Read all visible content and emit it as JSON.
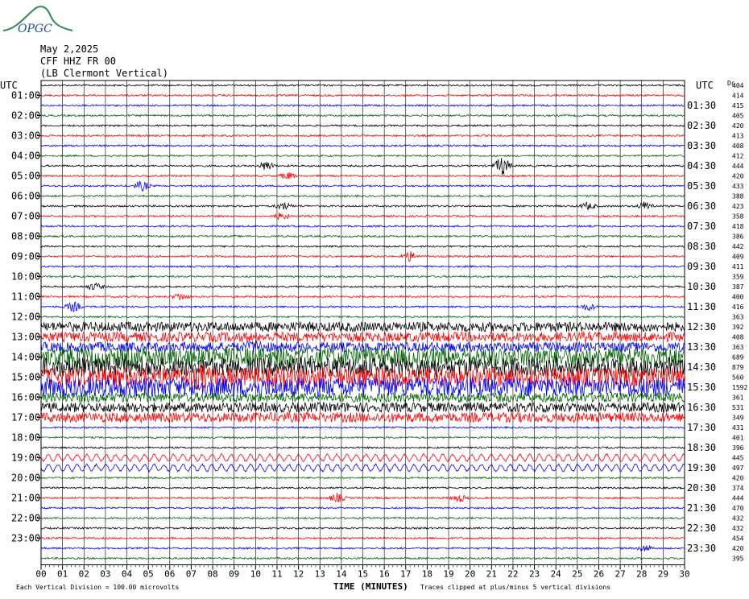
{
  "logo": {
    "text": "OPGC"
  },
  "header": {
    "date": "May 2,2025",
    "station": "CFF HHZ FR 00",
    "location": "(LB Clermont Vertical)"
  },
  "left_axis_title": "UTC",
  "right_axis_title": "UTC",
  "corner_label": "Dc",
  "colors": [
    "#000000",
    "#ff0000",
    "#0000ff",
    "#006400"
  ],
  "chart_data": {
    "type": "line",
    "title": "",
    "xlabel": "TIME (MINUTES)",
    "ylabel": "",
    "xlim": [
      0,
      30
    ],
    "x_ticks": [
      "00",
      "01",
      "02",
      "03",
      "04",
      "05",
      "06",
      "07",
      "08",
      "09",
      "10",
      "11",
      "12",
      "13",
      "14",
      "15",
      "16",
      "17",
      "18",
      "19",
      "20",
      "21",
      "22",
      "23",
      "24",
      "25",
      "26",
      "27",
      "28",
      "29",
      "30"
    ],
    "left_labels": [
      "01:00",
      "02:00",
      "03:00",
      "04:00",
      "05:00",
      "06:00",
      "07:00",
      "08:00",
      "09:00",
      "10:00",
      "11:00",
      "12:00",
      "13:00",
      "14:00",
      "15:00",
      "16:00",
      "17:00",
      "18:00",
      "19:00",
      "20:00",
      "21:00",
      "22:00",
      "23:00"
    ],
    "right_labels": [
      "01:30",
      "02:30",
      "03:30",
      "04:30",
      "05:30",
      "06:30",
      "07:30",
      "08:30",
      "09:30",
      "10:30",
      "11:30",
      "12:30",
      "13:30",
      "14:30",
      "15:30",
      "16:30",
      "17:30",
      "18:30",
      "19:30",
      "20:30",
      "21:30",
      "22:30",
      "23:30"
    ],
    "trace_levels": [
      404,
      414,
      415,
      405,
      420,
      413,
      408,
      412,
      444,
      420,
      433,
      388,
      423,
      358,
      418,
      386,
      442,
      409,
      411,
      359,
      387,
      400,
      416,
      363,
      392,
      408,
      363,
      689,
      879,
      560,
      1592,
      361,
      531,
      349,
      431,
      401,
      396,
      445,
      497,
      420,
      374,
      444,
      470,
      432,
      432,
      454,
      420,
      395
    ],
    "activity": [
      {
        "trace": 8,
        "minute": 10.5,
        "level": 2
      },
      {
        "trace": 8,
        "minute": 21.5,
        "level": 4
      },
      {
        "trace": 9,
        "minute": 11.5,
        "level": 1.5
      },
      {
        "trace": 10,
        "minute": 4.7,
        "level": 2
      },
      {
        "trace": 12,
        "minute": 11.3,
        "level": 1.5
      },
      {
        "trace": 12,
        "minute": 25.5,
        "level": 1.5
      },
      {
        "trace": 12,
        "minute": 28.2,
        "level": 2
      },
      {
        "trace": 13,
        "minute": 11.2,
        "level": 1.5
      },
      {
        "trace": 17,
        "minute": 17.2,
        "level": 2
      },
      {
        "trace": 20,
        "minute": 2.5,
        "level": 1.5
      },
      {
        "trace": 21,
        "minute": 6.5,
        "level": 1.5
      },
      {
        "trace": 22,
        "minute": 1.5,
        "level": 2
      },
      {
        "trace": 22,
        "minute": 25.5,
        "level": 1.5
      },
      {
        "trace": 26,
        "minute": 10,
        "level": 1.5
      },
      {
        "trace": 29,
        "minute": 7.5,
        "level": 2
      },
      {
        "trace": 41,
        "minute": 13.8,
        "level": 1.8
      },
      {
        "trace": 41,
        "minute": 19.5,
        "level": 1.5
      },
      {
        "trace": 46,
        "minute": 28.2,
        "level": 1.5
      }
    ],
    "noisy_traces": [
      24,
      25,
      26,
      27,
      28,
      29,
      30,
      31,
      32,
      33
    ],
    "grid": true
  },
  "footer": {
    "left": "Each Vertical Division =  100.00 microvolts",
    "center": "TIME (MINUTES)",
    "right": "Traces clipped at plus/minus 5 vertical divisions"
  }
}
